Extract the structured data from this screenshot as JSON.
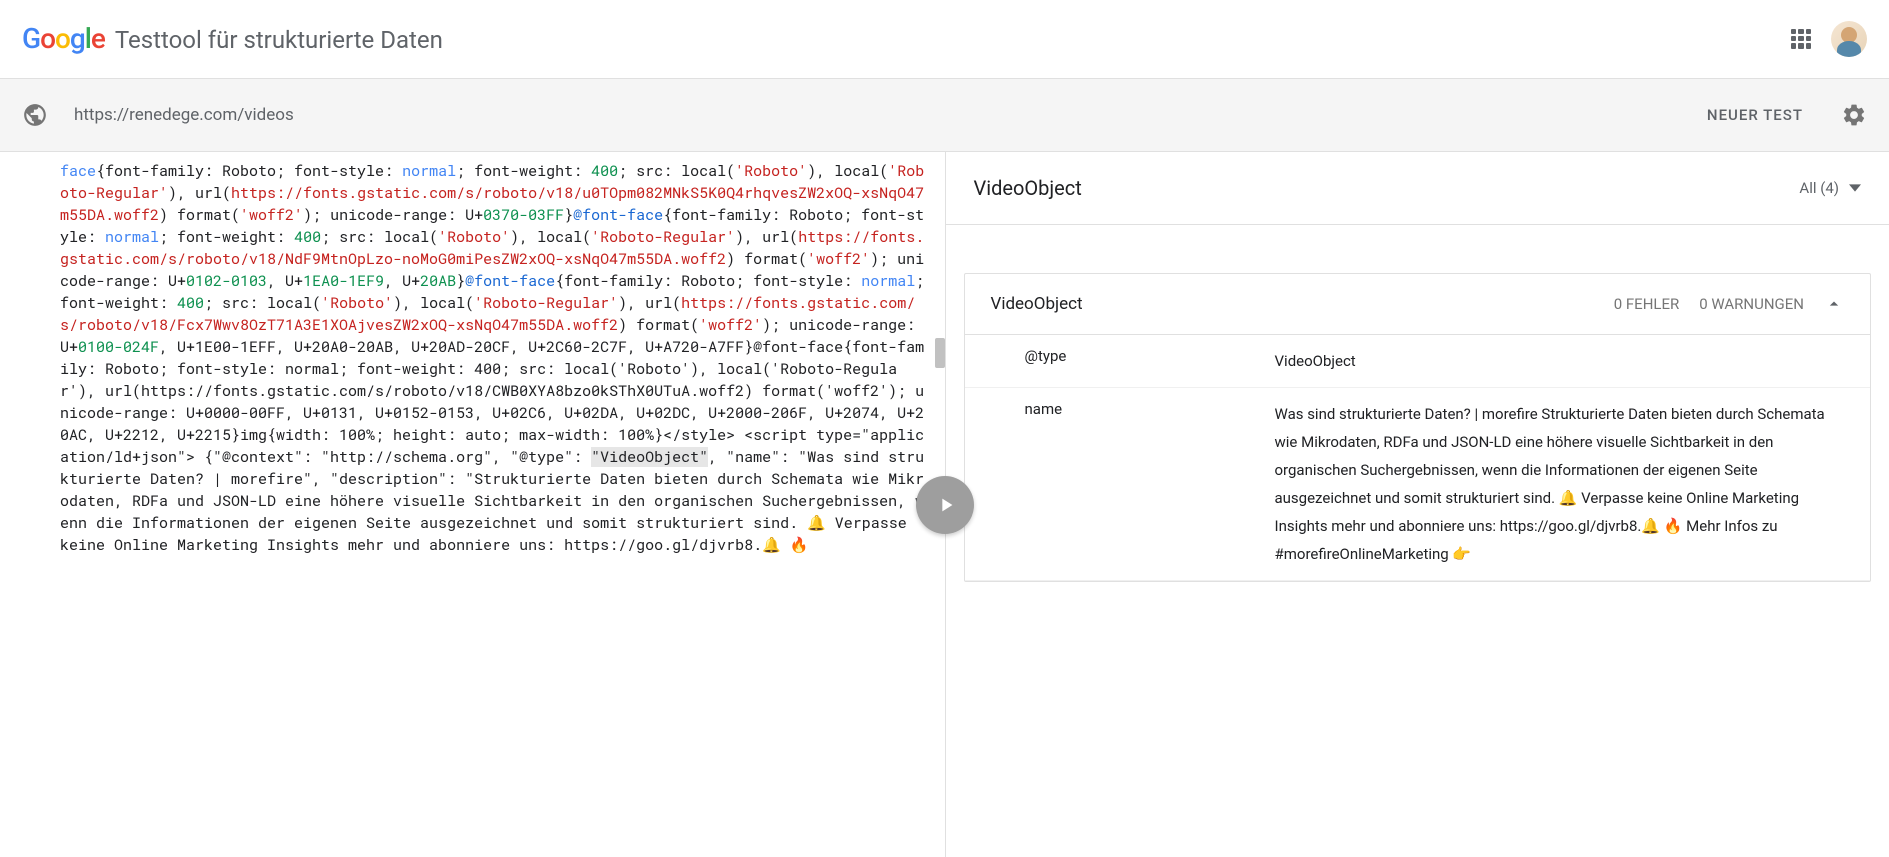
{
  "header": {
    "tool_title": "Testtool für strukturierte Daten"
  },
  "url_bar": {
    "url": "https://renedege.com/videos",
    "new_test": "NEUER TEST"
  },
  "results": {
    "title": "VideoObject",
    "filter": "All (4)",
    "detail": {
      "title": "VideoObject",
      "errors": "0 FEHLER",
      "warnings": "0 WARNUNGEN",
      "rows": [
        {
          "key": "@type",
          "val": "VideoObject"
        },
        {
          "key": "name",
          "val": "Was sind strukturierte Daten? | morefire Strukturierte Daten bieten durch Schemata wie Mikrodaten, RDFa und JSON-LD eine höhere visuelle Sichtbarkeit in den organischen Suchergebnissen, wenn die Informationen der eigenen Seite ausgezeichnet und somit strukturiert sind. 🔔 Verpasse keine Online Marketing Insights mehr und abonniere uns: https://goo.gl/djvrb8.🔔 🔥 Mehr Infos zu #morefireOnlineMarketing 👉"
        }
      ]
    }
  },
  "code": {
    "segments": [
      {
        "t": "face",
        "c": "k-face"
      },
      {
        "t": "{font-family: Roboto; font-style: "
      },
      {
        "t": "normal",
        "c": "k-normal"
      },
      {
        "t": "; font-weight: "
      },
      {
        "t": "400",
        "c": "k-num"
      },
      {
        "t": "; src: local("
      },
      {
        "t": "'Roboto'",
        "c": "k-str"
      },
      {
        "t": "), local("
      },
      {
        "t": "'Roboto-Regular'",
        "c": "k-str"
      },
      {
        "t": "), url("
      },
      {
        "t": "https://fonts.gstatic.com/s/roboto/v18/u0TOpm082MNkS5K0Q4rhqvesZW2xOQ-xsNqO47m55DA.woff2",
        "c": "k-url"
      },
      {
        "t": ") format("
      },
      {
        "t": "'woff2'",
        "c": "k-str"
      },
      {
        "t": "); unicode-range: U+"
      },
      {
        "t": "0370-03FF",
        "c": "k-range"
      },
      {
        "t": "}"
      },
      {
        "t": "@font-face",
        "c": "k-at"
      },
      {
        "t": "{font-family: Roboto; font-style: "
      },
      {
        "t": "normal",
        "c": "k-normal"
      },
      {
        "t": "; font-weight: "
      },
      {
        "t": "400",
        "c": "k-num"
      },
      {
        "t": "; src: local("
      },
      {
        "t": "'Roboto'",
        "c": "k-str"
      },
      {
        "t": "), local("
      },
      {
        "t": "'Roboto-Regular'",
        "c": "k-str"
      },
      {
        "t": "), url("
      },
      {
        "t": "https://fonts.gstatic.com/s/roboto/v18/NdF9MtnOpLzo-noMoG0miPesZW2xOQ-xsNqO47m55DA.woff2",
        "c": "k-url"
      },
      {
        "t": ") format("
      },
      {
        "t": "'woff2'",
        "c": "k-str"
      },
      {
        "t": "); unicode-range: U+"
      },
      {
        "t": "0102-0103",
        "c": "k-range"
      },
      {
        "t": ", U+"
      },
      {
        "t": "1EA0-1EF9",
        "c": "k-range"
      },
      {
        "t": ", U+"
      },
      {
        "t": "20AB",
        "c": "k-range"
      },
      {
        "t": "}"
      },
      {
        "t": "@font-face",
        "c": "k-at"
      },
      {
        "t": "{font-family: Roboto; font-style: "
      },
      {
        "t": "normal",
        "c": "k-normal"
      },
      {
        "t": "; font-weight: "
      },
      {
        "t": "400",
        "c": "k-num"
      },
      {
        "t": "; src: local("
      },
      {
        "t": "'Roboto'",
        "c": "k-str"
      },
      {
        "t": "), local("
      },
      {
        "t": "'Roboto-Regular'",
        "c": "k-str"
      },
      {
        "t": "), url("
      },
      {
        "t": "https://fonts.gstatic.com/s/roboto/v18/Fcx7Wwv8OzT71A3E1XOAjvesZW2xOQ-xsNqO47m55DA.woff2",
        "c": "k-url"
      },
      {
        "t": ") format("
      },
      {
        "t": "'woff2'",
        "c": "k-str"
      },
      {
        "t": "); unicode-range: U+"
      },
      {
        "t": "0100-024F",
        "c": "k-range"
      },
      {
        "t": ", U+1E00-1EFF, U+20A0-20AB, U+20AD-20CF, U+2C60-2C7F, U+A720-A7FF}@font-face{font-family: Roboto; font-style: normal; font-weight: 400; src: local('Roboto'), local('Roboto-Regular'), url(https://fonts.gstatic.com/s/roboto/v18/CWB0XYA8bzo0kSThX0UTuA.woff2) format('woff2'); unicode-range: U+0000-00FF, U+0131, U+0152-0153, U+02C6, U+02DA, U+02DC, U+2000-206F, U+2074, U+20AC, U+2212, U+2215}img{width: 100%; height: auto; max-width: 100%}</style> <script type=\"application/ld+json\"> {\"@context\": \"http://schema.org\", \"@type\": "
      },
      {
        "t": "\"VideoObject\"",
        "c": "hl"
      },
      {
        "t": ", \"name\": \"Was sind strukturierte Daten? | morefire\", \"description\": \"Strukturierte Daten bieten durch Schemata wie Mikrodaten, RDFa und JSON-LD eine höhere visuelle Sichtbarkeit in den organischen Suchergebnissen, wenn die Informationen der eigenen Seite ausgezeichnet und somit strukturiert sind. 🔔 Verpasse keine Online Marketing Insights mehr und abonniere uns: https://goo.gl/djvrb8.🔔 🔥"
      }
    ]
  }
}
